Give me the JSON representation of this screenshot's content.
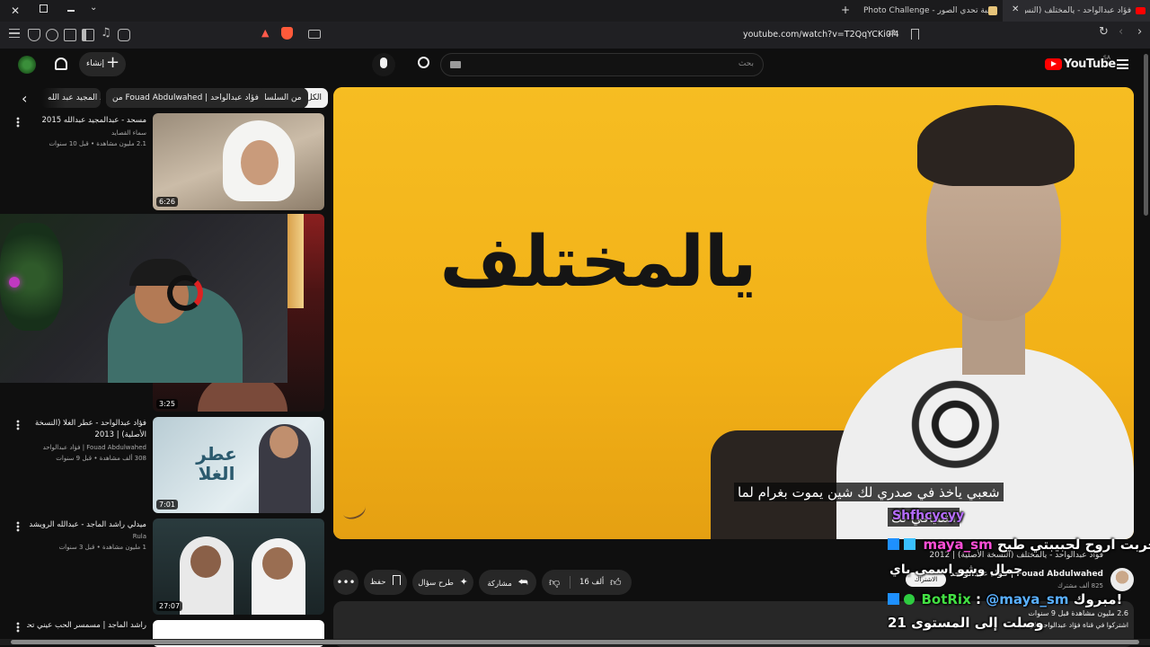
{
  "browser": {
    "tabs": [
      {
        "label": "Photo Challenge - لعبة تحدي الصور"
      },
      {
        "label": "فؤاد عبدالواحد - يالمختلف (النس..."
      }
    ],
    "url": "youtube.com/watch?v=T2QqYCKi0i4"
  },
  "header": {
    "logo": "YouTube",
    "region": "SA",
    "create_label": "إنشاء",
    "search_placeholder": "بحث"
  },
  "chips": [
    "الكل",
    "من السلسلة",
    "من Fouad Abdulwahed | فؤاد عبدالواحد",
    "عبد المجيد عبد الله"
  ],
  "sidebar_videos": [
    {
      "title": "مسحد - عبدالمجيد عبدالله 2015",
      "channel": "سماء القصايد",
      "meta": "2.1 مليون مشاهدة • قبل 10 سنوات",
      "duration": "6:26"
    },
    {
      "title": "",
      "channel": "",
      "meta": "",
      "duration": "3:25"
    },
    {
      "title": "فؤاد عبدالواحد - عطر الغلا (النسخة الأصلية) | 2013",
      "channel": "Fouad Abdulwahed | فؤاد عبدالواحد",
      "meta": "308 ألف مشاهدة • قبل 9 سنوات",
      "duration": "7:01",
      "thumb_text": "عطر الغلا"
    },
    {
      "title": "ميدلي راشد الماجد - عبدالله الرويشد",
      "channel": "Rula",
      "meta": "1 مليون مشاهدة • قبل 3 سنوات",
      "duration": "27:07"
    },
    {
      "title": "راشد الماجد | مسمسر الحب عيني تحب عيونك |",
      "channel": "",
      "meta": "",
      "duration": ""
    }
  ],
  "player": {
    "title_art": "يالمختلف",
    "subtitle": "شعبي ياخذ في صدري لك شين يموت بغرام لما",
    "subtitle2": "اشتياقي لك"
  },
  "actions": {
    "likes": "16 ألف",
    "share": "مشاركة",
    "ask": "طرح سؤال",
    "save": "حفظ"
  },
  "below_video": {
    "title": "فؤاد عبدالواحد - يالمختلف (النسخة الأصلية) | 2012",
    "channel": "Fouad Abdulwahed | فؤاد عبدالواحد",
    "subs": "825 ألف مشترك",
    "views": "2.6 مليون مشاهدة  قبل 9 سنوات",
    "desc": "اشتركوا في قناة فؤاد عبدالواحد الرسمية",
    "subscribe": "الاشتراك"
  },
  "chat_overlay": {
    "line1": "جربت اروح لحبيبتي طيح",
    "user1": "maya_sm",
    "line2": "جمال وشو اسمي ياي",
    "user_mention": "Shfhcycyy",
    "bot": "BotRix",
    "mention": "@maya_sm",
    "bot_msg": "مبروك!",
    "level_msg": "وصلت إلى المستوى 21"
  }
}
